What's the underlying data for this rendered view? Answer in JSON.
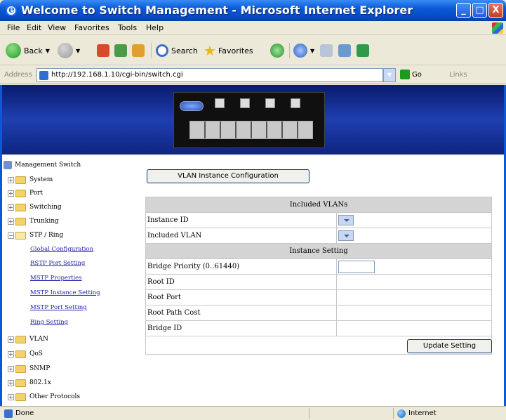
{
  "window": {
    "title": "Welcome to Switch Management - Microsoft Internet Explorer",
    "minimize_glyph": "_",
    "maximize_glyph": "□",
    "close_glyph": "X"
  },
  "menu": {
    "items": [
      "File",
      "Edit",
      "View",
      "Favorites",
      "Tools",
      "Help"
    ]
  },
  "toolbar": {
    "back": "Back",
    "search": "Search",
    "favorites": "Favorites"
  },
  "address": {
    "label": "Address",
    "url": "http://192.168.1.10/cgi-bin/switch.cgi",
    "go": "Go",
    "links": "Links"
  },
  "sidebar": {
    "root": "Management Switch",
    "items": [
      "System",
      "Port",
      "Switching",
      "Trunking",
      "STP / Ring"
    ],
    "stp_children": [
      "Global Configuration",
      "RSTP Port Setting",
      "MSTP Properties",
      "MSTP Instance Setting",
      "MSTP Port Setting",
      "Ring Setting"
    ],
    "items_after": [
      "VLAN",
      "QoS",
      "SNMP",
      "802.1x",
      "Other Protocols"
    ]
  },
  "main": {
    "vlan_instance_button": "VLAN Instance Configuration",
    "included_vlans_header": "Included VLANs",
    "instance_id_label": "Instance ID",
    "included_vlan_label": "Included VLAN",
    "instance_setting_header": "Instance Setting",
    "bridge_priority_label": "Bridge Priority (0..61440)",
    "root_id_label": "Root ID",
    "root_port_label": "Root Port",
    "root_path_cost_label": "Root Path Cost",
    "bridge_id_label": "Bridge ID",
    "update_button": "Update Setting"
  },
  "status": {
    "left": "Done",
    "zone": "Internet"
  },
  "colors": {
    "titlebar": "#0a5ad8",
    "banner": "#1f3fb0",
    "table_header": "#d4d4d4",
    "link": "#2222aa"
  }
}
